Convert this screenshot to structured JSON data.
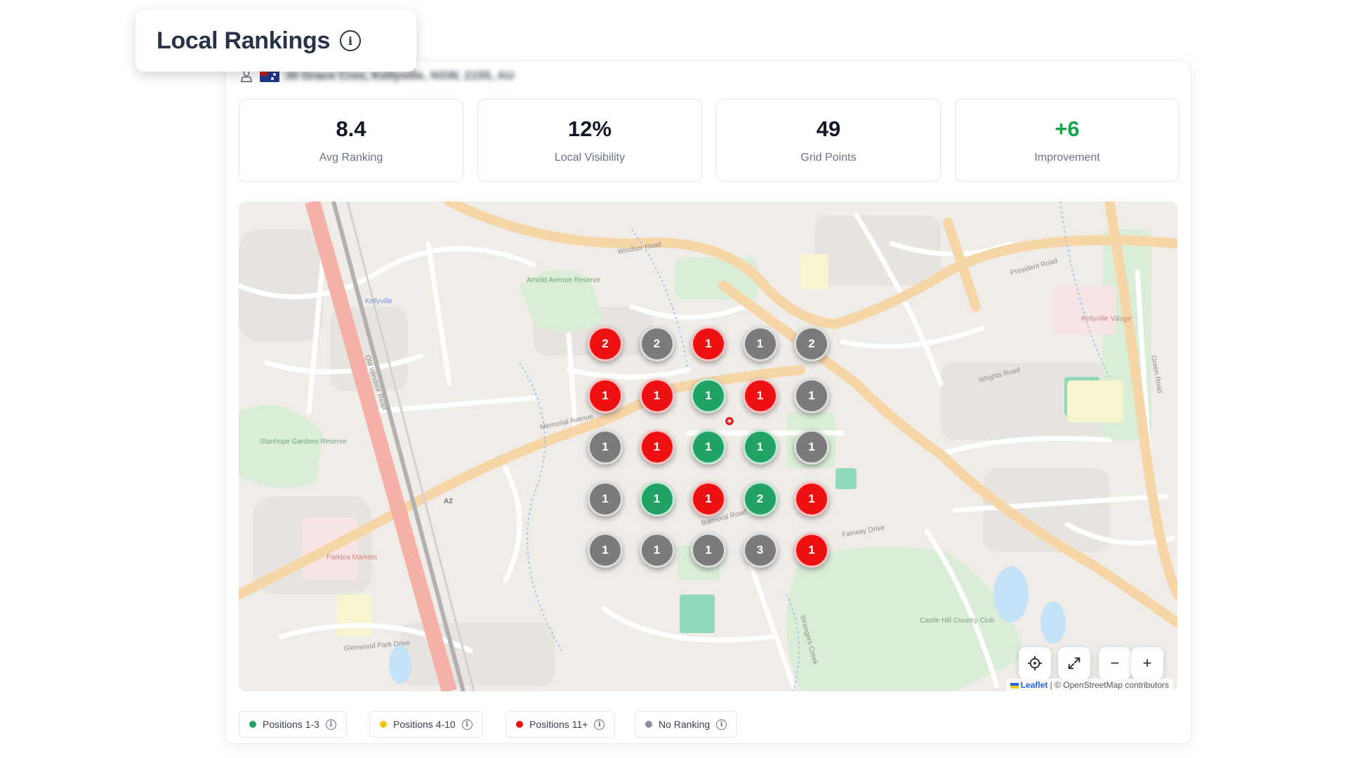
{
  "header": {
    "title": "Local Rankings",
    "info_icon": "info-icon"
  },
  "location": {
    "address": "30 Grace Cres, Kellyville, NSW, 2155, AU",
    "flag": "AU"
  },
  "stats": [
    {
      "value": "8.4",
      "label": "Avg Ranking"
    },
    {
      "value": "12%",
      "label": "Local Visibility"
    },
    {
      "value": "49",
      "label": "Grid Points"
    },
    {
      "value": "+6",
      "label": "Improvement",
      "color": "#16a34a"
    }
  ],
  "map": {
    "street_labels": [
      "Windsor Road",
      "Memorial Avenue",
      "Balmoral Road",
      "Old Windsor Road",
      "Green Road",
      "Fairway Drive",
      "Wrights Road",
      "Arnold Avenue Reserve",
      "Kellyville Village",
      "Castle Hill Country Club",
      "Stanhope Gardens Reserve",
      "Parklea Markets",
      "President Road",
      "Glenwood Park Drive",
      "Strangers Creek",
      "Kellyville",
      "A2"
    ],
    "grid": [
      [
        {
          "rank": "2",
          "status": "red"
        },
        {
          "rank": "2",
          "status": "gray"
        },
        {
          "rank": "1",
          "status": "red"
        },
        {
          "rank": "1",
          "status": "gray"
        },
        {
          "rank": "2",
          "status": "gray"
        }
      ],
      [
        {
          "rank": "1",
          "status": "red"
        },
        {
          "rank": "1",
          "status": "red"
        },
        {
          "rank": "1",
          "status": "green"
        },
        {
          "rank": "1",
          "status": "red"
        },
        {
          "rank": "1",
          "status": "gray"
        }
      ],
      [
        {
          "rank": "1",
          "status": "gray"
        },
        {
          "rank": "1",
          "status": "red"
        },
        {
          "rank": "1",
          "status": "green"
        },
        {
          "rank": "1",
          "status": "green"
        },
        {
          "rank": "1",
          "status": "gray"
        }
      ],
      [
        {
          "rank": "1",
          "status": "gray"
        },
        {
          "rank": "1",
          "status": "green"
        },
        {
          "rank": "1",
          "status": "red"
        },
        {
          "rank": "2",
          "status": "green"
        },
        {
          "rank": "1",
          "status": "red"
        }
      ],
      [
        {
          "rank": "1",
          "status": "gray"
        },
        {
          "rank": "1",
          "status": "gray"
        },
        {
          "rank": "1",
          "status": "gray"
        },
        {
          "rank": "3",
          "status": "gray"
        },
        {
          "rank": "1",
          "status": "red"
        }
      ]
    ],
    "status_colors": {
      "green": "#21a366",
      "red": "#ee1111",
      "gray": "#7b7b7b",
      "yellow": "#f5c518"
    },
    "controls": {
      "locate": "crosshair-icon",
      "fullscreen": "expand-icon",
      "zoom_out": "−",
      "zoom_in": "+"
    },
    "attribution": {
      "leaflet": "Leaflet",
      "separator": " | © ",
      "osm": "OpenStreetMap contributors"
    }
  },
  "legend": [
    {
      "label": "Positions 1-3",
      "color": "#21a366"
    },
    {
      "label": "Positions 4-10",
      "color": "#f5c518"
    },
    {
      "label": "Positions 11+",
      "color": "#ee1111"
    },
    {
      "label": "No Ranking",
      "color": "#8a8f98"
    }
  ]
}
